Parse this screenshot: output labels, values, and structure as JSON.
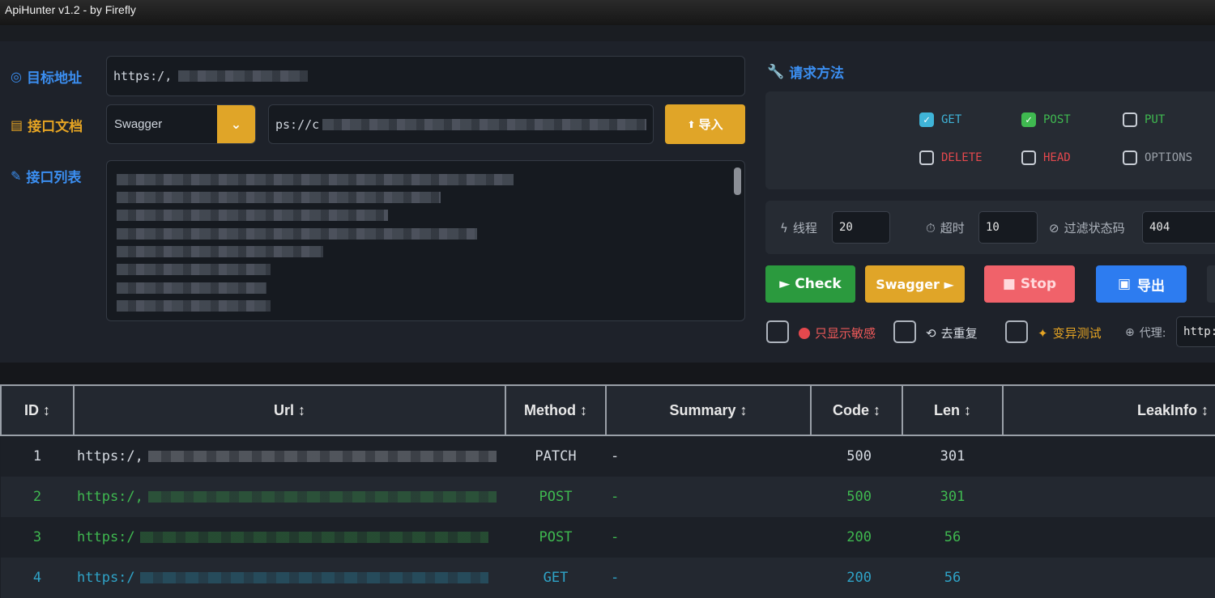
{
  "window": {
    "title": "ApiHunter v1.2 - by Firefly"
  },
  "target": {
    "label": "目标地址",
    "value": "https:/,"
  },
  "doc": {
    "label": "接口文档",
    "type": "Swagger",
    "url": "ps://c",
    "import_button": "导入"
  },
  "list": {
    "label": "接口列表",
    "lines": [
      "ւր",
      "",
      "dc",
      "d",
      "",
      "t",
      "",
      "er",
      "re"
    ]
  },
  "methods": {
    "title": "请求方法",
    "items": [
      {
        "name": "GET",
        "checked": true,
        "color": "#3fb4d8"
      },
      {
        "name": "POST",
        "checked": true,
        "color": "#3fb950"
      },
      {
        "name": "PUT",
        "checked": false,
        "color": "#3fb950"
      },
      {
        "name": "DELETE",
        "checked": false,
        "color": "#e5484d"
      },
      {
        "name": "HEAD",
        "checked": false,
        "color": "#e5484d"
      },
      {
        "name": "OPTIONS",
        "checked": false,
        "color": "#9aa0a8"
      }
    ]
  },
  "params": {
    "threads_label": "线程",
    "threads": "20",
    "timeout_label": "超时",
    "timeout": "10",
    "filter_label": "过滤状态码",
    "filter": "404"
  },
  "actions": {
    "check": "► Check",
    "swagger": "Swagger ►",
    "stop": "■ Stop",
    "export": "导出"
  },
  "options": {
    "sensitive": "只显示敏感",
    "dedupe": "去重复",
    "mutate": "变异测试",
    "proxy_label": "代理:",
    "proxy_value": "http:"
  },
  "table": {
    "headers": [
      "ID ↕",
      "Url ↕",
      "Method ↕",
      "Summary ↕",
      "Code ↕",
      "Len ↕",
      "LeakInfo ↕"
    ],
    "rows": [
      {
        "id": "1",
        "url": "https:/,",
        "method": "PATCH",
        "summary": "-",
        "code": "500",
        "len": "301",
        "leak": "",
        "color": "#d6dbe2"
      },
      {
        "id": "2",
        "url": "https:/,",
        "method": "POST",
        "summary": "-",
        "code": "500",
        "len": "301",
        "leak": "",
        "color": "#3fb950"
      },
      {
        "id": "3",
        "url": "https:/",
        "method": "POST",
        "summary": "-",
        "code": "200",
        "len": "56",
        "leak": "",
        "color": "#3fb950"
      },
      {
        "id": "4",
        "url": "https:/",
        "method": "GET",
        "summary": "-",
        "code": "200",
        "len": "56",
        "leak": "",
        "color": "#2fa4c8"
      }
    ]
  }
}
